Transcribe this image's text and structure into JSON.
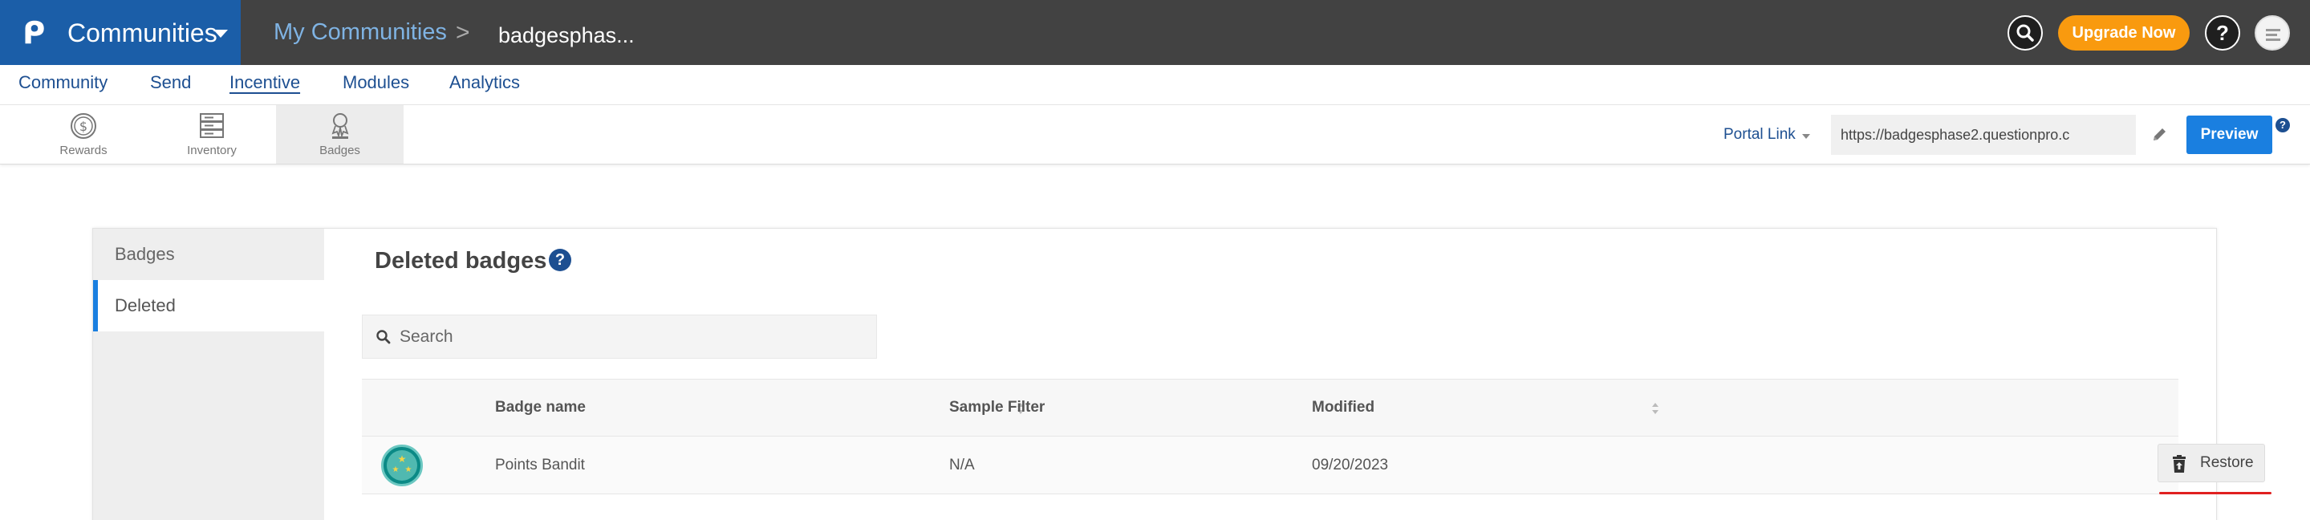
{
  "header": {
    "app_name": "Communities",
    "breadcrumb": [
      "My Communities",
      "badgesphas..."
    ],
    "breadcrumb_separator": ">",
    "upgrade_label": "Upgrade Now",
    "help_label": "?",
    "colors": {
      "bar": "#424242",
      "brand": "#1b5ea8",
      "upgrade": "#f99a0f"
    }
  },
  "nav": {
    "items": [
      {
        "label": "Community"
      },
      {
        "label": "Send"
      },
      {
        "label": "Incentive",
        "active": true
      },
      {
        "label": "Modules"
      },
      {
        "label": "Analytics"
      }
    ]
  },
  "subnav": {
    "tabs": [
      {
        "label": "Rewards",
        "icon": "dollar-coin-icon"
      },
      {
        "label": "Inventory",
        "icon": "inventory-icon"
      },
      {
        "label": "Badges",
        "icon": "trophy-icon",
        "active": true
      }
    ],
    "portal_link_label": "Portal Link",
    "portal_url": "https://badgesphase2.questionpro.c",
    "preview_label": "Preview",
    "preview_help": "?"
  },
  "sidebar": {
    "items": [
      {
        "label": "Badges"
      },
      {
        "label": "Deleted",
        "active": true
      }
    ]
  },
  "main": {
    "title": "Deleted badges",
    "title_help": "?",
    "search_placeholder": "Search",
    "table": {
      "columns": [
        "Badge name",
        "Sample Filter",
        "Modified"
      ],
      "rows": [
        {
          "name": "Points Bandit",
          "filter": "N/A",
          "modified": "09/20/2023",
          "action": "Restore"
        }
      ]
    }
  }
}
